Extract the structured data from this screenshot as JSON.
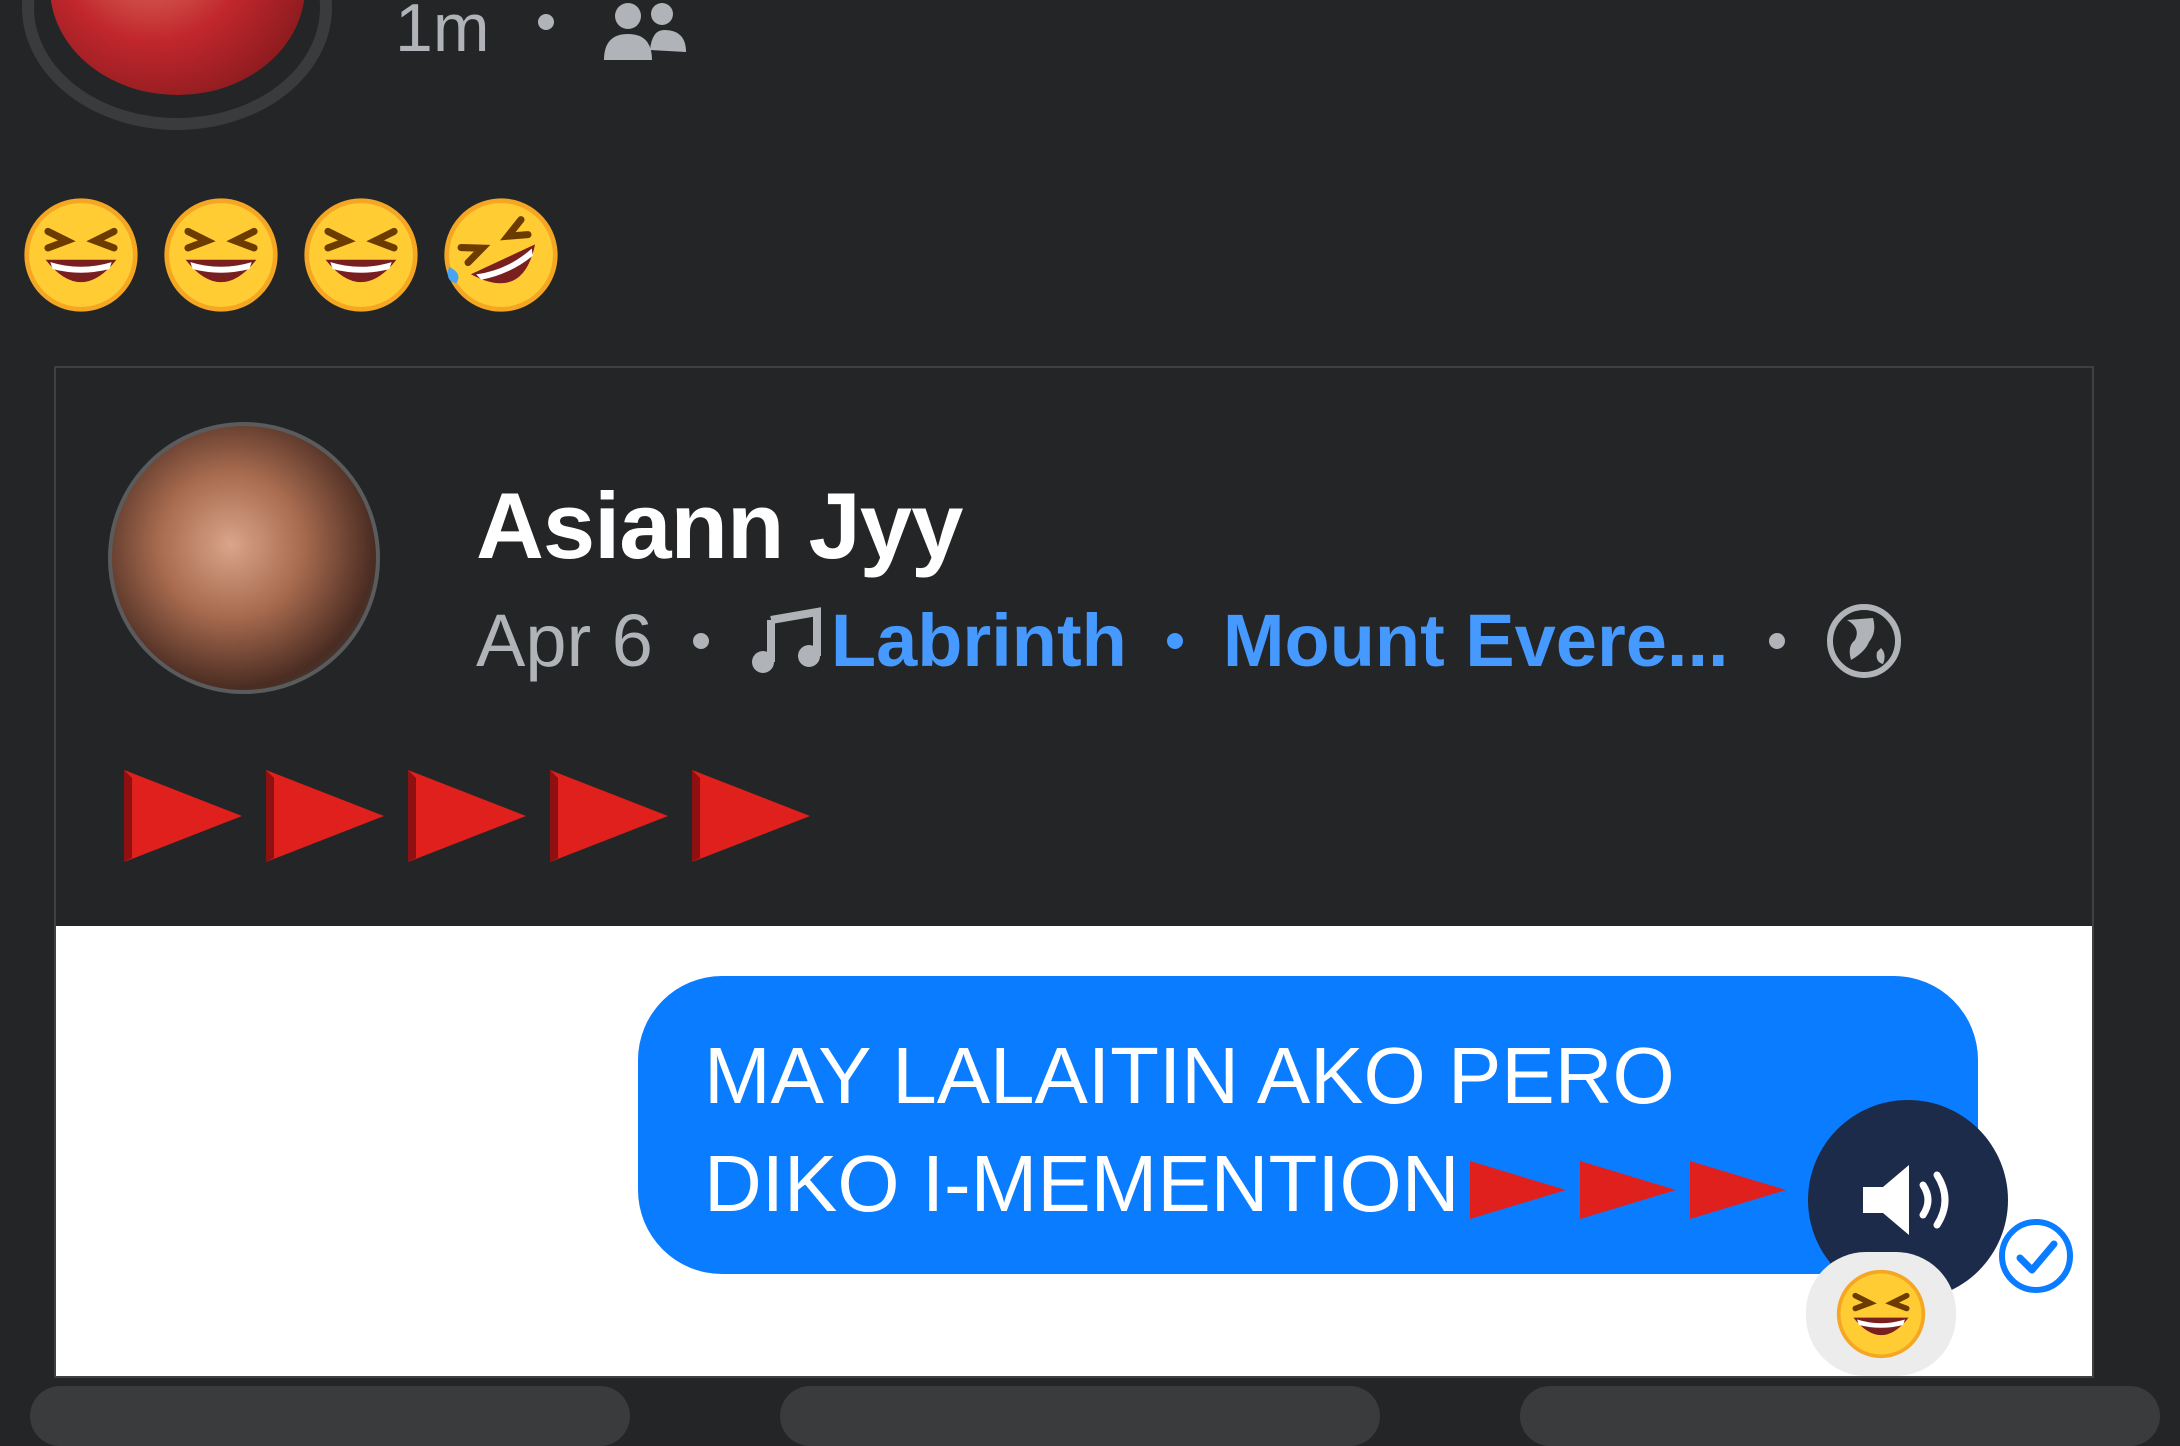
{
  "post": {
    "time": "1m",
    "audience_icon": "friends-icon",
    "emojis": [
      "laughing-emoji",
      "laughing-emoji",
      "laughing-emoji",
      "rolling-laughing-emoji"
    ]
  },
  "shared_post": {
    "author": "Asiann Jyy",
    "date": "Apr 6",
    "music_icon": "music-note-icon",
    "song_artist": "Labrinth",
    "song_title": "Mount Evere...",
    "privacy_icon": "globe-icon",
    "flags_count": 5
  },
  "screenshot": {
    "message_line1": "MAY LALAITIN AKO PERO",
    "message_line2": "DIKO I-MEMENTION",
    "message_color": "#0a7cff",
    "reaction": "laughing-emoji",
    "speaker_icon": "speaker-icon",
    "status_icon": "sent-check-icon"
  }
}
